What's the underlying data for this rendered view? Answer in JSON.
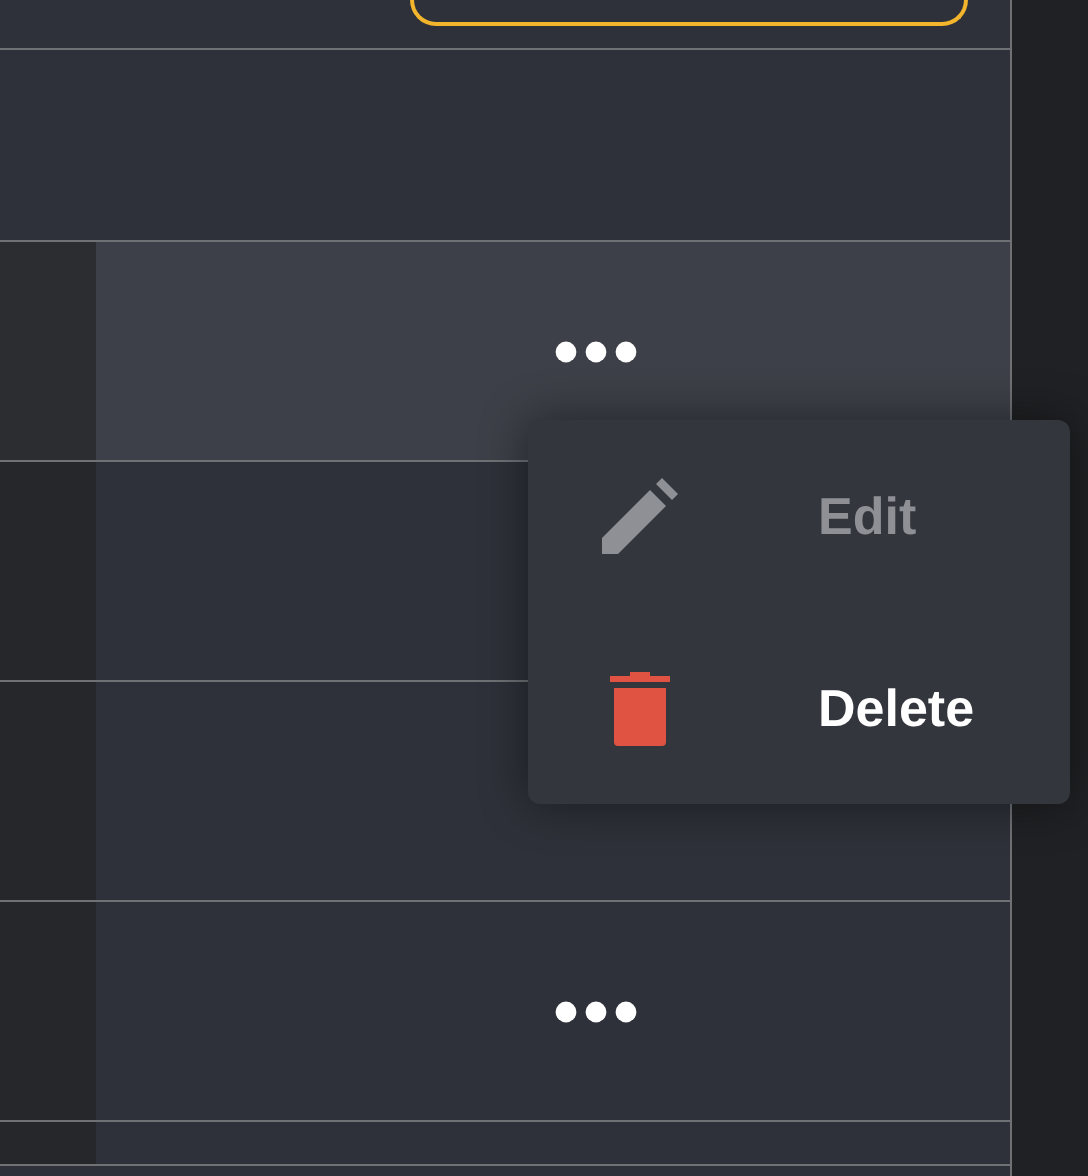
{
  "rows": [
    {
      "selected": true
    },
    {
      "selected": false
    },
    {
      "selected": false
    },
    {
      "selected": false
    }
  ],
  "context_menu": {
    "items": [
      {
        "kind": "edit",
        "label": "Edit",
        "disabled": true
      },
      {
        "kind": "delete",
        "label": "Delete",
        "disabled": false
      }
    ]
  }
}
